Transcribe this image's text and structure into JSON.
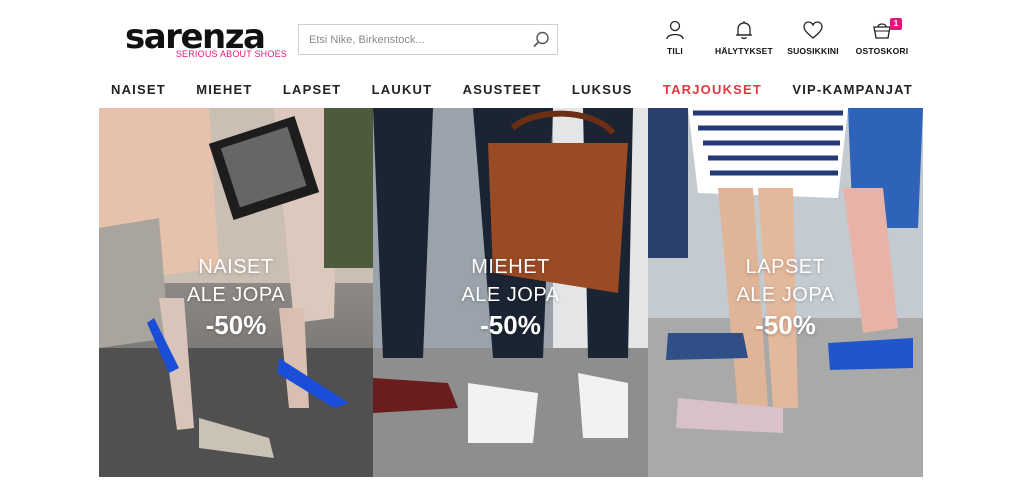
{
  "brand": {
    "name": "sarenza",
    "tagline": "SERIOUS ABOUT SHOES",
    "accent_color": "#e5177e"
  },
  "search": {
    "placeholder": "Etsi Nike, Birkenstock...",
    "icon": "search-icon"
  },
  "account_menu": [
    {
      "label": "TILI",
      "icon": "user-icon"
    },
    {
      "label": "HÄLYTYKSET",
      "icon": "bell-icon"
    },
    {
      "label": "SUOSIKKINI",
      "icon": "heart-icon"
    },
    {
      "label": "OSTOSKORI",
      "icon": "cart-icon",
      "badge": "1"
    }
  ],
  "nav": [
    {
      "label": "NAISET"
    },
    {
      "label": "MIEHET"
    },
    {
      "label": "LAPSET"
    },
    {
      "label": "LAUKUT"
    },
    {
      "label": "ASUSTEET"
    },
    {
      "label": "LUKSUS"
    },
    {
      "label": "TARJOUKSET",
      "color": "#e2383f"
    },
    {
      "label": "VIP-KAMPANJAT"
    }
  ],
  "banners": [
    {
      "line1": "NAISET",
      "line2": "ALE JOPA",
      "line3": "-50%"
    },
    {
      "line1": "MIEHET",
      "line2": "ALE JOPA",
      "line3": "-50%"
    },
    {
      "line1": "LAPSET",
      "line2": "ALE JOPA",
      "line3": "-50%"
    }
  ]
}
